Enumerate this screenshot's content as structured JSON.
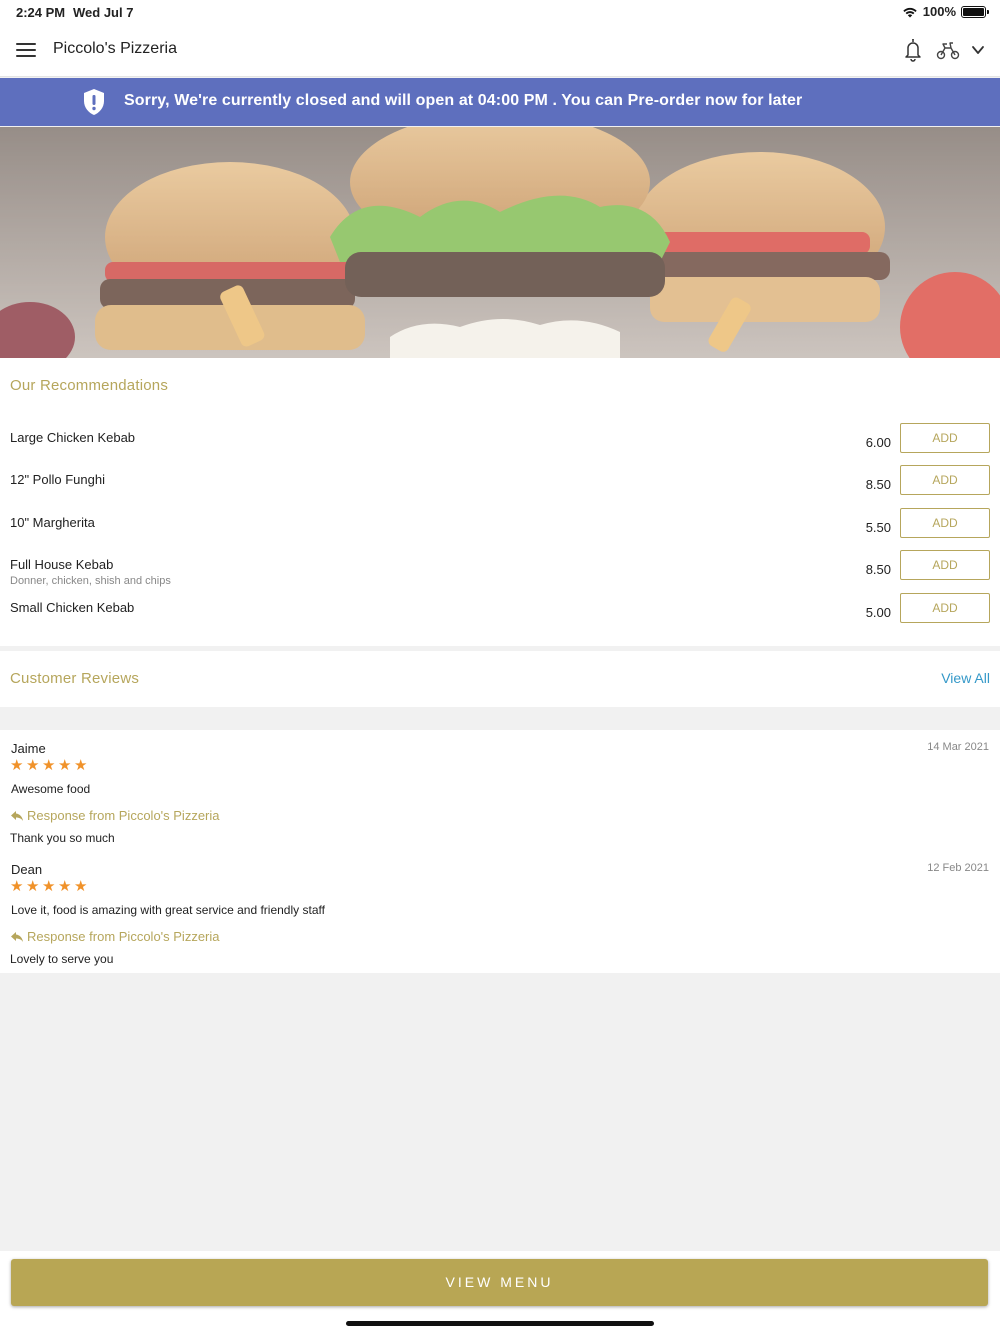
{
  "status_bar": {
    "time": "2:24 PM",
    "date": "Wed Jul 7",
    "battery": "100%"
  },
  "nav": {
    "title": "Piccolo's Pizzeria"
  },
  "banner": {
    "text": "Sorry, We're currently closed and will open at 04:00 PM . You can Pre-order now for later"
  },
  "recommendations": {
    "heading": "Our Recommendations",
    "add_label": "ADD",
    "items": [
      {
        "name": "Large Chicken Kebab",
        "description": "",
        "price": "6.00"
      },
      {
        "name": "12\" Pollo Funghi",
        "description": "",
        "price": "8.50"
      },
      {
        "name": "10\" Margherita",
        "description": "",
        "price": "5.50"
      },
      {
        "name": "Full House Kebab",
        "description": "Donner, chicken, shish and chips",
        "price": "8.50"
      },
      {
        "name": "Small Chicken Kebab",
        "description": "",
        "price": "5.00"
      }
    ]
  },
  "reviews": {
    "heading": "Customer Reviews",
    "view_all": "View All",
    "items": [
      {
        "name": "Jaime",
        "date": "14 Mar 2021",
        "rating": 5,
        "text": "Awesome food",
        "response_label": "Response from Piccolo's Pizzeria",
        "response": "Thank you so much"
      },
      {
        "name": "Dean",
        "date": "12 Feb 2021",
        "rating": 5,
        "text": "Love it, food is amazing with great service and friendly staff",
        "response_label": "Response from Piccolo's Pizzeria",
        "response": "Lovely to serve you"
      }
    ]
  },
  "footer": {
    "view_menu": "VIEW MENU"
  },
  "colors": {
    "accent": "#b6a65c",
    "banner": "#5e6fbe",
    "link": "#3498c8",
    "star": "#f0922a"
  }
}
